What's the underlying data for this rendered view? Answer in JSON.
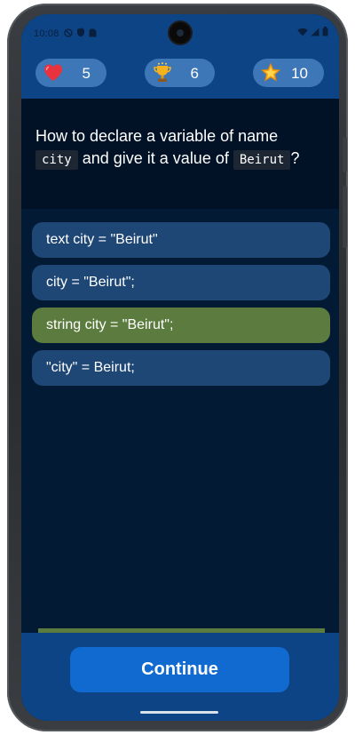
{
  "status_bar": {
    "time": "10:08",
    "left_icons": [
      "do-not-disturb-icon",
      "shield-icon",
      "sim-icon"
    ],
    "right_icons": [
      "wifi-icon",
      "signal-icon",
      "battery-icon"
    ]
  },
  "stats": {
    "lives": {
      "icon": "heart-icon",
      "value": "5"
    },
    "trophies": {
      "icon": "trophy-icon",
      "value": "6"
    },
    "stars": {
      "icon": "star-icon",
      "value": "10"
    }
  },
  "question": {
    "part1": "How to declare a variable of name",
    "code1": "city",
    "part2": "and give it a value of",
    "code2": "Beirut",
    "part3": "?"
  },
  "options": [
    {
      "label": "text city = \"Beirut\"",
      "state": "default"
    },
    {
      "label": "city = \"Beirut\";",
      "state": "default"
    },
    {
      "label": "string city = \"Beirut\";",
      "state": "correct"
    },
    {
      "label": "\"city\" = Beirut;",
      "state": "default"
    }
  ],
  "progress": {
    "fraction": 1.0
  },
  "footer": {
    "continue_label": "Continue"
  },
  "colors": {
    "header_bg": "#0d4485",
    "question_bg": "#011227",
    "content_bg": "#031a35",
    "option_bg": "#1e4775",
    "correct_bg": "#5c7b3e",
    "button_bg": "#116ad0",
    "stat_pill_bg": "#3e77b7"
  }
}
